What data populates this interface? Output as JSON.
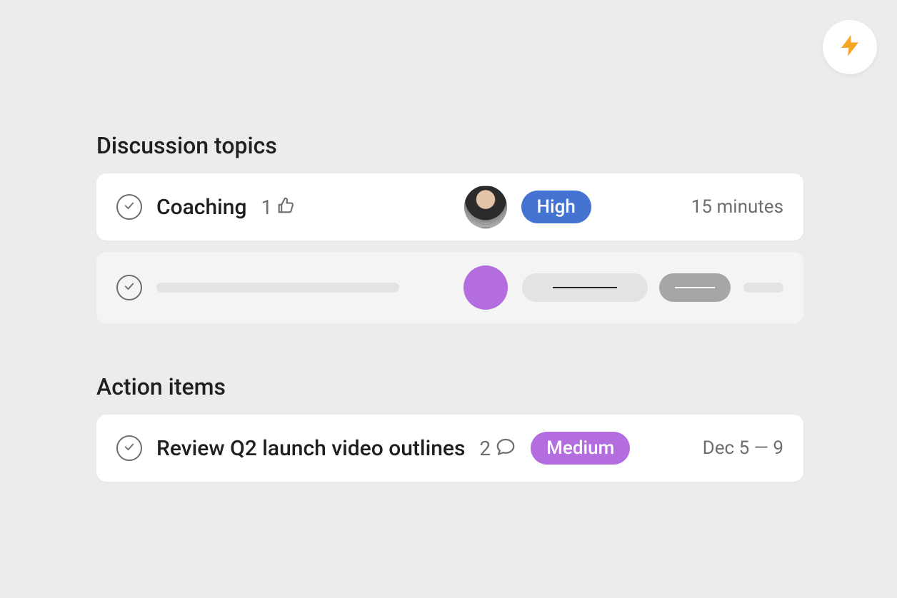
{
  "lightning_icon": "lightning",
  "sections": {
    "discussion": {
      "title": "Discussion topics",
      "items": [
        {
          "title": "Coaching",
          "likes": "1",
          "priority_label": "High",
          "duration": "15 minutes"
        }
      ]
    },
    "action": {
      "title": "Action items",
      "items": [
        {
          "title": "Review Q2 launch video outlines",
          "comments": "2",
          "priority_label": "Medium",
          "date_range": "Dec 5 — 9"
        }
      ]
    }
  },
  "colors": {
    "high": "#4573d2",
    "medium": "#b36dde",
    "placeholder_avatar": "#b36dde"
  }
}
